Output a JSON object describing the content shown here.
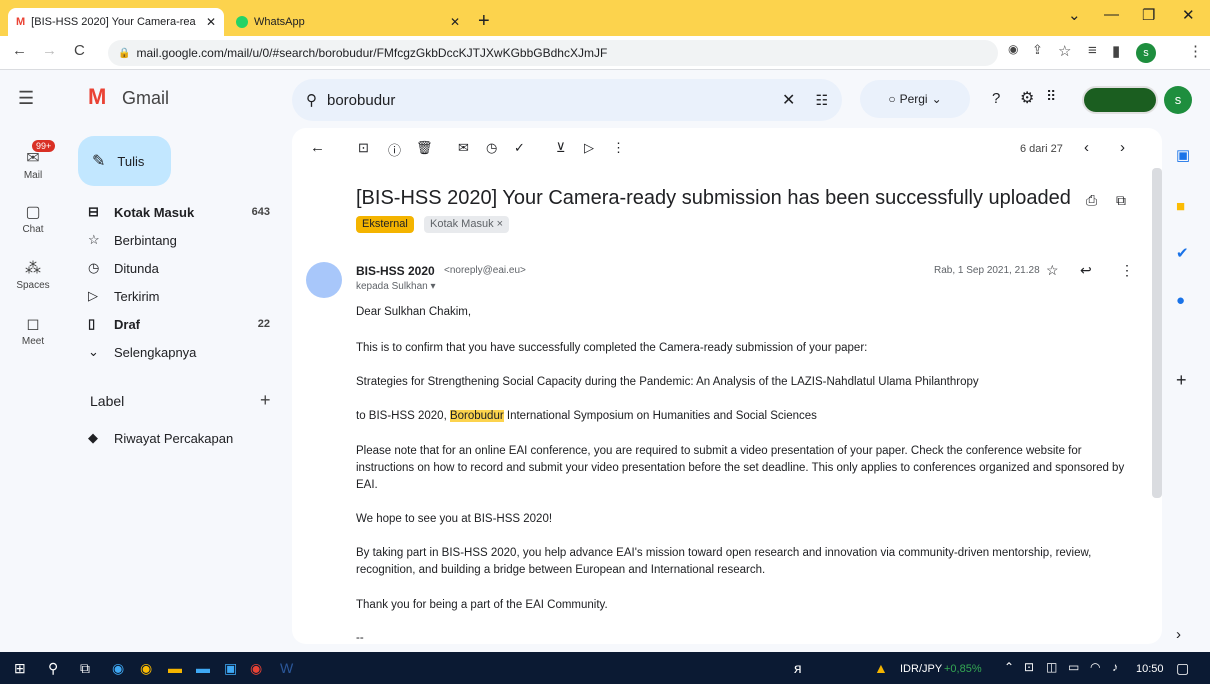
{
  "browser": {
    "tab1_title": "[BIS-HSS 2020] Your Camera-rea",
    "tab2_title": "WhatsApp",
    "url": "mail.google.com/mail/u/0/#search/borobudur/FMfcgzGkbDccKJTJXwKGbbGBdhcXJmJF"
  },
  "gmail": {
    "brand": "Gmail",
    "search_value": "borobudur",
    "status_label": "Pergi",
    "avatar_letter": "s"
  },
  "rail": {
    "mail_badge": "99+",
    "items": [
      "Mail",
      "Chat",
      "Spaces",
      "Meet"
    ]
  },
  "sidebar": {
    "compose": "Tulis",
    "items": [
      {
        "label": "Kotak Masuk",
        "count": "643"
      },
      {
        "label": "Berbintang",
        "count": ""
      },
      {
        "label": "Ditunda",
        "count": ""
      },
      {
        "label": "Terkirim",
        "count": ""
      },
      {
        "label": "Draf",
        "count": "22"
      },
      {
        "label": "Selengkapnya",
        "count": ""
      }
    ],
    "label_header": "Label",
    "labels": [
      "Riwayat Percakapan"
    ]
  },
  "message": {
    "pagination": "6 dari 27",
    "subject": "[BIS-HSS 2020] Your Camera-ready submission has been successfully uploaded",
    "chip_external": "Eksternal",
    "chip_inbox": "Kotak Masuk ×",
    "sender_name": "BIS-HSS 2020",
    "sender_email": "<noreply@eai.eu>",
    "to_line": "kepada Sulkhan ▾",
    "date": "Rab, 1 Sep 2021, 21.28",
    "greeting": "Dear Sulkhan Chakim,",
    "p1": "This is to confirm that you have successfully completed the Camera-ready submission of your paper:",
    "p2": "Strategies for Strengthening Social Capacity during the Pandemic: An Analysis of the LAZIS-Nahdlatul Ulama Philanthropy",
    "p3_pre": "to BIS-HSS 2020, ",
    "p3_hl": "Borobudur",
    "p3_post": " International Symposium on Humanities and Social Sciences",
    "p4": "Please note that for an online EAI conference, you are required to submit a video presentation of your paper. Check the conference website for instructions on how to record and submit your video presentation before the set deadline. This only applies to conferences organized and sponsored by EAI.",
    "p5": "We hope to see you at BIS-HSS 2020!",
    "p6": "By taking part in BIS-HSS 2020, you help advance EAI's mission toward open research and innovation via community-driven mentorship, review, recognition, and building a bridge between European and International research.",
    "p7": "Thank you for being a part of the EAI Community.",
    "p8": "--"
  },
  "taskbar": {
    "ticker_pair": "IDR/JPY",
    "ticker_change": "+0,85%",
    "time": "10:50"
  }
}
